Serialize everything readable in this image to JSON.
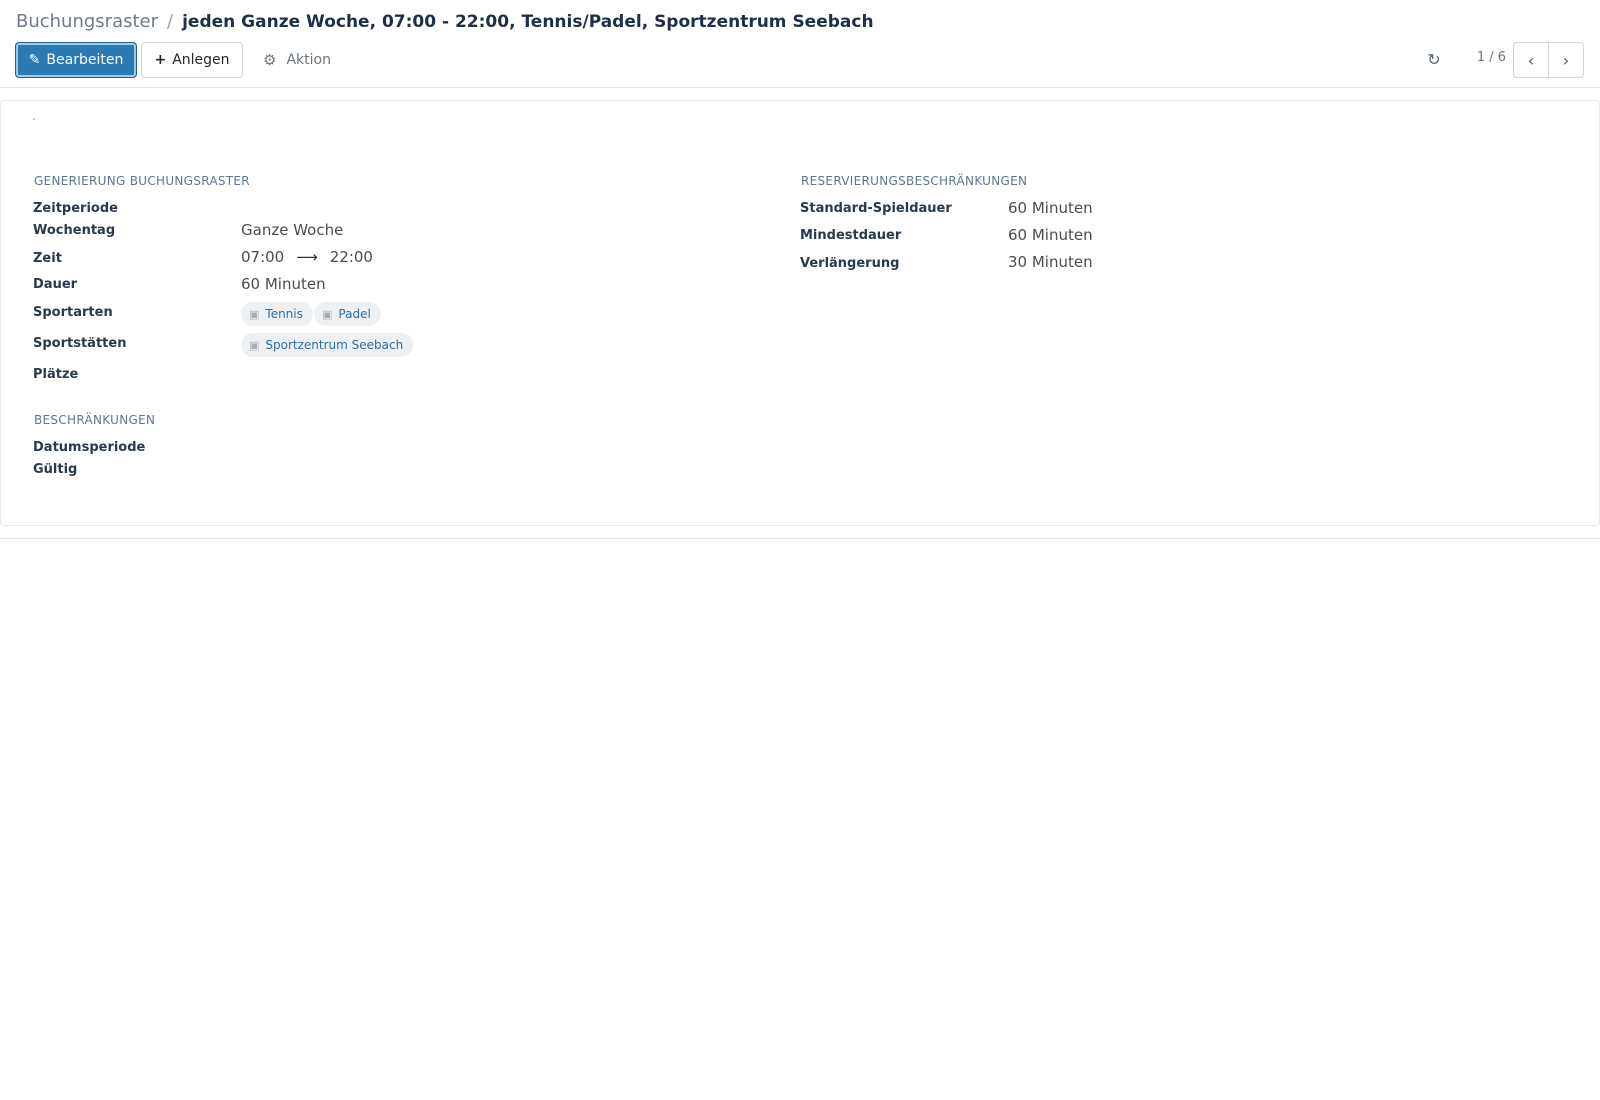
{
  "breadcrumb": {
    "parent": "Buchungsraster",
    "separator": "/",
    "current": "jeden Ganze Woche, 07:00 - 22:00, Tennis/Padel, Sportzentrum Seebach"
  },
  "toolbar": {
    "edit_label": "Bearbeiten",
    "create_label": "Anlegen",
    "action_label": "Aktion"
  },
  "pager": {
    "value": "1 / 6"
  },
  "colors": {
    "primary": "#2b7ab4",
    "tag_text": "#2f6da3",
    "group_title": "#5f7590"
  },
  "left_group": {
    "title": "GENERIERUNG BUCHUNGSRASTER",
    "fields": {
      "zeitperiode": {
        "label": "Zeitperiode"
      },
      "wochentag": {
        "label": "Wochentag",
        "value": "Ganze Woche"
      },
      "zeit": {
        "label": "Zeit",
        "from": "07:00",
        "to": "22:00"
      },
      "dauer": {
        "label": "Dauer",
        "value": "60 Minuten"
      },
      "sportarten": {
        "label": "Sportarten",
        "tags": [
          "Tennis",
          "Padel"
        ]
      },
      "sportstaetten": {
        "label": "Sportstätten",
        "tags": [
          "Sportzentrum Seebach"
        ]
      },
      "plaetze": {
        "label": "Plätze"
      }
    }
  },
  "restrictions_group": {
    "title": "BESCHRÄNKUNGEN",
    "fields": {
      "datumsperiode": {
        "label": "Datumsperiode"
      },
      "gueltig": {
        "label": "Gültig"
      }
    }
  },
  "right_group": {
    "title": "RESERVIERUNGSBESCHRÄNKUNGEN",
    "fields": {
      "standard": {
        "label": "Standard-Spieldauer",
        "value": "60 Minuten"
      },
      "mindest": {
        "label": "Mindestdauer",
        "value": "60 Minuten"
      },
      "verlaengerung": {
        "label": "Verlängerung",
        "value": "30 Minuten"
      }
    }
  },
  "icons": {
    "edit": "pencil-icon",
    "create": "plus-icon",
    "action": "gear-icon",
    "reload": "refresh-icon",
    "prev": "chevron-left-icon",
    "next": "chevron-right-icon",
    "tag": "camera-icon"
  }
}
